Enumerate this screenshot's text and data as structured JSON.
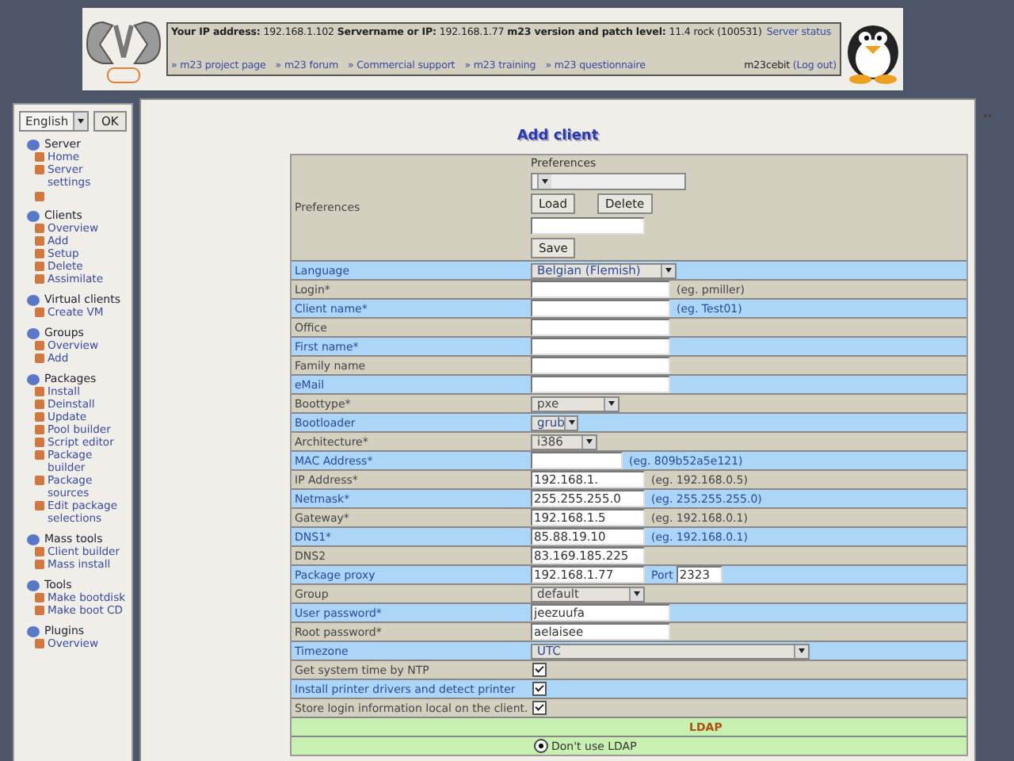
{
  "header": {
    "info": "**Your IP address:** 192.168.1.102 **Servername or IP:** 192.168.1.77 **m23 version and patch level:** 11.4 rock (100531)",
    "status_link": "Server status",
    "links": [
      "» m23 project page",
      "» m23 forum",
      "» Commercial support",
      "» m23 training",
      "» m23 questionnaire"
    ],
    "user": "m23cebit",
    "logout": "(Log out)"
  },
  "sidebar": {
    "language": "English",
    "ok": "OK",
    "sections": [
      {
        "title": "Server",
        "items": [
          {
            "kind": "link",
            "label": "Home"
          },
          {
            "kind": "link",
            "label": "Server settings"
          },
          {
            "kind": "icon"
          }
        ]
      },
      {
        "title": "Clients",
        "items": [
          {
            "kind": "link",
            "label": "Overview"
          },
          {
            "kind": "link",
            "label": "Add"
          },
          {
            "kind": "link",
            "label": "Setup"
          },
          {
            "kind": "link",
            "label": "Delete"
          },
          {
            "kind": "link",
            "label": "Assimilate"
          }
        ]
      },
      {
        "title": "Virtual clients",
        "items": [
          {
            "kind": "link",
            "label": "Create VM"
          }
        ]
      },
      {
        "title": "Groups",
        "items": [
          {
            "kind": "link",
            "label": "Overview"
          },
          {
            "kind": "link",
            "label": "Add"
          }
        ]
      },
      {
        "title": "Packages",
        "items": [
          {
            "kind": "link",
            "label": "Install"
          },
          {
            "kind": "link",
            "label": "Deinstall"
          },
          {
            "kind": "link",
            "label": "Update"
          },
          {
            "kind": "link",
            "label": "Pool builder"
          },
          {
            "kind": "link",
            "label": "Script editor"
          },
          {
            "kind": "link",
            "label": "Package builder"
          },
          {
            "kind": "link",
            "label": "Package sources"
          },
          {
            "kind": "link",
            "label": "Edit package selections"
          }
        ]
      },
      {
        "title": "Mass tools",
        "items": [
          {
            "kind": "link",
            "label": "Client builder"
          },
          {
            "kind": "link",
            "label": "Mass install"
          }
        ]
      },
      {
        "title": "Tools",
        "items": [
          {
            "kind": "link",
            "label": "Make bootdisk"
          },
          {
            "kind": "link",
            "label": "Make boot CD"
          }
        ]
      },
      {
        "title": "Plugins",
        "items": [
          {
            "kind": "link",
            "label": "Overview"
          }
        ]
      }
    ]
  },
  "form": {
    "title": "Add client",
    "preferences": {
      "label": "Preferences",
      "heading": "Preferences",
      "load": "Load",
      "delete": "Delete",
      "save": "Save"
    },
    "rows": [
      {
        "kind": "select",
        "label": "Language",
        "value": "Belgian (Flemish)"
      },
      {
        "kind": "text",
        "label": "Login*",
        "hint": "(eg. pmiller)"
      },
      {
        "kind": "text",
        "label": "Client name*",
        "hint": "(eg. Test01)"
      },
      {
        "kind": "text",
        "label": "Office"
      },
      {
        "kind": "text",
        "label": "First name*"
      },
      {
        "kind": "text",
        "label": "Family name"
      },
      {
        "kind": "text",
        "label": "eMail"
      },
      {
        "kind": "select",
        "label": "Boottype*",
        "value": "pxe"
      },
      {
        "kind": "select",
        "label": "Bootloader",
        "value": "grub"
      },
      {
        "kind": "select",
        "label": "Architecture*",
        "value": "i386"
      },
      {
        "kind": "mac",
        "label": "MAC Address*",
        "hint": "(eg. 809b52a5e121)"
      },
      {
        "kind": "ip",
        "label": "IP Address*",
        "value": "192.168.1.",
        "hint": "(eg. 192.168.0.5)"
      },
      {
        "kind": "ip",
        "label": "Netmask*",
        "value": "255.255.255.0",
        "hint": "(eg. 255.255.255.0)"
      },
      {
        "kind": "ip",
        "label": "Gateway*",
        "value": "192.168.1.5",
        "hint": "(eg. 192.168.0.1)"
      },
      {
        "kind": "ip",
        "label": "DNS1*",
        "value": "85.88.19.10",
        "hint": "(eg. 192.168.0.1)"
      },
      {
        "kind": "ip",
        "label": "DNS2",
        "value": "83.169.185.225"
      },
      {
        "kind": "proxy",
        "label": "Package proxy",
        "value": "192.168.1.77",
        "port_label": "Port",
        "port": "2323"
      },
      {
        "kind": "select",
        "label": "Group",
        "value": "default"
      },
      {
        "kind": "text",
        "label": "User password*",
        "value": "jeezuufa"
      },
      {
        "kind": "text",
        "label": "Root password*",
        "value": "aelaisee"
      },
      {
        "kind": "select",
        "label": "Timezone",
        "value": "UTC"
      },
      {
        "kind": "checkbox",
        "label": "Get system time by NTP",
        "checked": true
      },
      {
        "kind": "checkbox",
        "label": "Install printer drivers and detect printer",
        "checked": true
      },
      {
        "kind": "checkbox",
        "label": "Store login information local on the client.",
        "checked": true
      }
    ],
    "ldap": {
      "heading": "LDAP",
      "options": [
        {
          "label": "Don't use LDAP",
          "selected": true
        }
      ]
    }
  }
}
